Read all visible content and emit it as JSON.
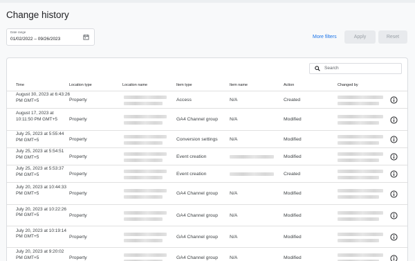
{
  "page": {
    "title": "Change history"
  },
  "date_range": {
    "label": "Date range",
    "value": "01/02/2022 – 09/26/2023"
  },
  "toolbar": {
    "more_filters": "More filters",
    "apply": "Apply",
    "reset": "Reset"
  },
  "search": {
    "placeholder": "Search"
  },
  "table": {
    "headers": [
      "Time",
      "Location type",
      "Location name",
      "Item type",
      "Item name",
      "Action",
      "Changed by"
    ],
    "rows": [
      {
        "time": "August 30, 2023 at 6:43:26 PM GMT+5",
        "location_type": "Property",
        "item_type": "Access",
        "item_name": "N/A",
        "action": "Created"
      },
      {
        "time": "August 17, 2023 at 10:11:50 PM GMT+5",
        "location_type": "Property",
        "item_type": "GA4 Channel group",
        "item_name": "N/A",
        "action": "Modified"
      },
      {
        "time": "July 25, 2023 at 5:55:44 PM GMT+5",
        "location_type": "Property",
        "item_type": "Conversion settings",
        "item_name": "N/A",
        "action": "Modified"
      },
      {
        "time": "July 25, 2023 at 5:54:51 PM GMT+5",
        "location_type": "Property",
        "item_type": "Event creation",
        "item_name": "",
        "action": "Modified"
      },
      {
        "time": "July 25, 2023 at 5:53:37 PM GMT+5",
        "location_type": "Property",
        "item_type": "Event creation",
        "item_name": "",
        "action": "Created"
      },
      {
        "time": "July 20, 2023 at 10:44:33 PM GMT+5",
        "location_type": "Property",
        "item_type": "GA4 Channel group",
        "item_name": "N/A",
        "action": "Modified"
      },
      {
        "time": "July 20, 2023 at 10:22:26 PM GMT+5",
        "location_type": "Property",
        "item_type": "GA4 Channel group",
        "item_name": "N/A",
        "action": "Modified"
      },
      {
        "time": "July 20, 2023 at 10:19:14 PM GMT+5",
        "location_type": "Property",
        "item_type": "GA4 Channel group",
        "item_name": "N/A",
        "action": "Modified"
      },
      {
        "time": "July 20, 2023 at 9:20:02 PM GMT+5",
        "location_type": "Property",
        "item_type": "GA4 Channel group",
        "item_name": "N/A",
        "action": "Modified"
      }
    ]
  },
  "icons": {
    "calendar": "calendar-icon",
    "search": "search-icon",
    "info": "info-icon"
  },
  "colors": {
    "link": "#1a73e8",
    "disabled_button": "#e8eaed"
  }
}
